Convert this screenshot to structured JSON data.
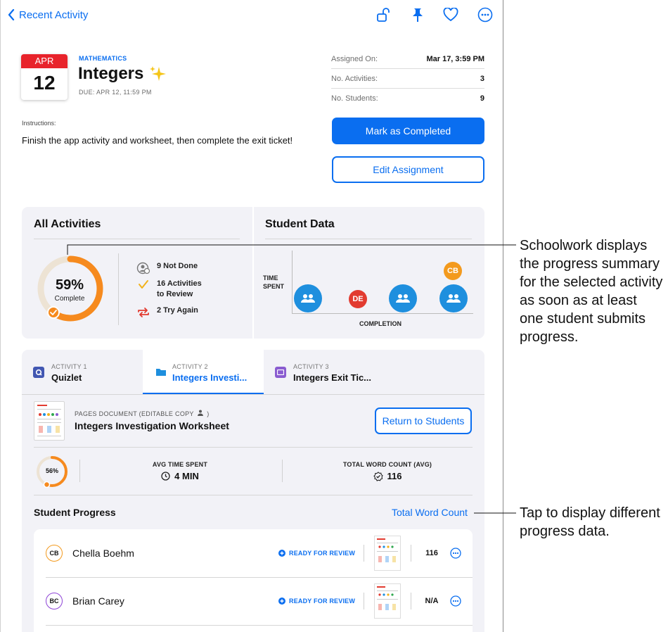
{
  "nav": {
    "back_label": "Recent Activity",
    "icons": [
      "unlock-icon",
      "pin-icon",
      "heart-icon",
      "more-icon"
    ]
  },
  "assignment": {
    "calendar_month": "APR",
    "calendar_day": "12",
    "subject": "MATHEMATICS",
    "title": "Integers",
    "due": "DUE: APR 12, 11:59 PM",
    "instructions_label": "Instructions:",
    "instructions": "Finish the app activity and worksheet, then complete the exit ticket!",
    "meta": [
      {
        "key": "Assigned On:",
        "value": "Mar 17, 3:59 PM"
      },
      {
        "key": "No. Activities:",
        "value": "3"
      },
      {
        "key": "No. Students:",
        "value": "9"
      }
    ],
    "primary_button": "Mark as Completed",
    "secondary_button": "Edit Assignment"
  },
  "summary": {
    "all_activities_title": "All Activities",
    "student_data_title": "Student Data",
    "percent": "59%",
    "percent_value": 0.59,
    "percent_label": "Complete",
    "stats": [
      {
        "icon": "not-done-icon",
        "line1": "9 Not Done",
        "line2": ""
      },
      {
        "icon": "checkmark-icon",
        "line1": "16 Activities",
        "line2": "to Review"
      },
      {
        "icon": "try-again-icon",
        "line1": "2 Try Again",
        "line2": ""
      }
    ],
    "y_axis_label_1": "TIME",
    "y_axis_label_2": "SPENT",
    "x_axis_label": "COMPLETION",
    "bubbles": [
      {
        "label": "",
        "kind": "group",
        "color": "#1e8fde"
      },
      {
        "label": "DE",
        "kind": "student",
        "color": "#e23b30"
      },
      {
        "label": "",
        "kind": "group",
        "color": "#1e8fde"
      },
      {
        "label": "",
        "kind": "group",
        "color": "#1e8fde"
      },
      {
        "label": "CB",
        "kind": "student",
        "color": "#f39a1e"
      }
    ]
  },
  "activities": {
    "tabs": [
      {
        "kicker": "ACTIVITY 1",
        "name": "Quizlet",
        "icon": "quizlet-icon",
        "active": false
      },
      {
        "kicker": "ACTIVITY 2",
        "name": "Integers Investi...",
        "icon": "folder-icon",
        "active": true
      },
      {
        "kicker": "ACTIVITY 3",
        "name": "Integers Exit Tic...",
        "icon": "exit-ticket-icon",
        "active": false
      }
    ],
    "doc_kind": "PAGES DOCUMENT (EDITABLE COPY",
    "doc_name": "Integers Investigation Worksheet",
    "return_button": "Return to Students",
    "mini_percent": "56%",
    "mini_percent_value": 0.56,
    "avg_time_label": "AVG TIME SPENT",
    "avg_time_value": "4 MIN",
    "word_count_label": "TOTAL WORD COUNT (AVG)",
    "word_count_value": "116",
    "progress_title": "Student Progress",
    "progress_filter": "Total Word Count",
    "students": [
      {
        "initials": "CB",
        "name": "Chella Boehm",
        "status": "READY FOR REVIEW",
        "count": "116",
        "color": "#f39a1e"
      },
      {
        "initials": "BC",
        "name": "Brian Carey",
        "status": "READY FOR REVIEW",
        "count": "N/A",
        "color": "#8e44d6"
      }
    ]
  },
  "callouts": {
    "summary": "Schoolwork displays the progress summary for the selected activity as soon as at least one student submits progress.",
    "filter": "Tap to display different progress data."
  },
  "colors": {
    "accent": "#0a6ef0",
    "ring": "#f68a1e",
    "calendar_red": "#e8232b"
  }
}
